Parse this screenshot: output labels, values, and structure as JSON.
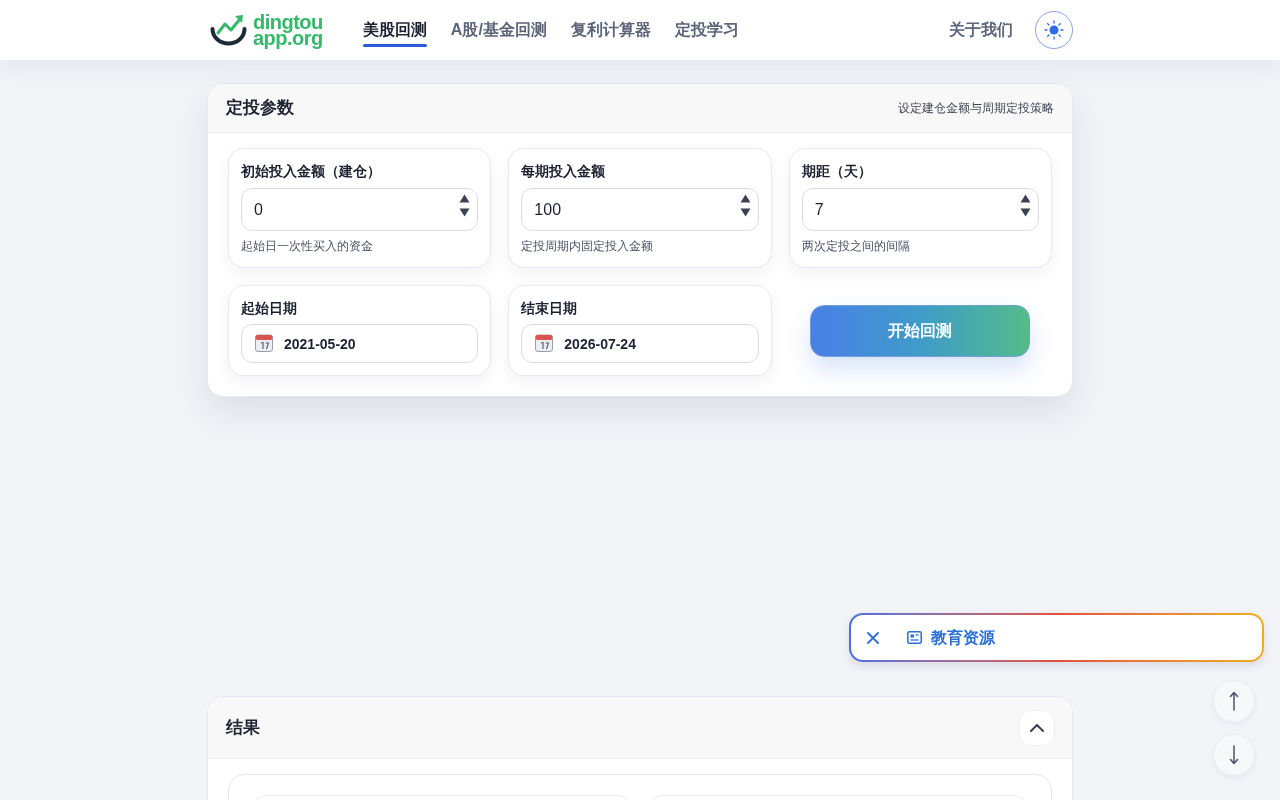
{
  "header": {
    "logo": {
      "line_1": "dingtou",
      "line_2": "app.org"
    },
    "nav": [
      {
        "label": "美股回测",
        "selected": true
      },
      {
        "label": "A股/基金回测",
        "selected": false
      },
      {
        "label": "复利计算器",
        "selected": false
      },
      {
        "label": "定投学习",
        "selected": false
      }
    ],
    "about": "关于我们"
  },
  "params": {
    "title": "定投参数",
    "subtitle": "设定建仓金额与周期定投策略",
    "fields": [
      {
        "kind": "number",
        "label": "初始投入金额（建仓）",
        "value": "0",
        "hint": "起始日一次性买入的资金"
      },
      {
        "kind": "number",
        "label": "每期投入金额",
        "value": "100",
        "hint": "定投周期内固定投入金额"
      },
      {
        "kind": "number",
        "label": "期距（天）",
        "value": "7",
        "hint": "两次定投之间的间隔"
      },
      {
        "kind": "date",
        "label": "起始日期",
        "value": "2021-05-20"
      },
      {
        "kind": "date",
        "label": "结束日期",
        "value": "2026-07-24"
      }
    ],
    "run_button": "开始回测"
  },
  "edu_panel": {
    "label": "教育资源"
  },
  "results": {
    "title": "结果",
    "expanded": true
  }
}
